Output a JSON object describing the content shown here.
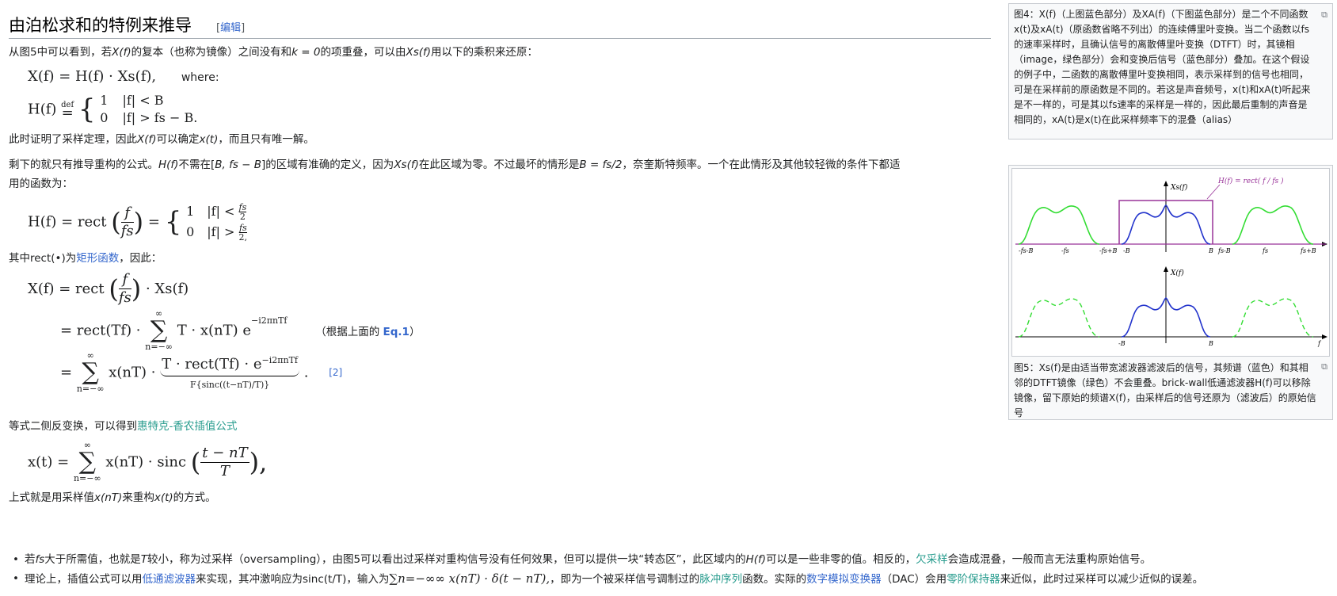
{
  "section": {
    "title": "由泊松求和的特例来推导",
    "edit_prefix": "[",
    "edit_label": "编辑",
    "edit_suffix": "]"
  },
  "para1": {
    "text_a": "从图5中可以看到，若",
    "xf": "X(f)",
    "text_b": "的复本（也称为镜像）之间没有和",
    "k0": "k = 0",
    "text_c": "的项重叠，可以由",
    "xsf": "Xs(f)",
    "text_d": "用以下的乘积来还原："
  },
  "eq1": {
    "lhs": "X(f) = H(f) · Xs(f),",
    "where": "where:"
  },
  "eq2": {
    "lhs": "H(f)",
    "def": "def",
    "eq": "=",
    "case1_val": "1",
    "case1_cond": "|f| < B",
    "case2_val": "0",
    "case2_cond": "|f| > fs − B."
  },
  "para2": {
    "text_a": "此时证明了采样定理，因此",
    "xf": "X(f)",
    "text_b": "可以确定",
    "xt": "x(t)",
    "text_c": "，而且只有唯一解。"
  },
  "para3": {
    "line1_a": "剩下的就只有推导重构的公式。",
    "hf": "H(f)",
    "line1_b": "不需在[",
    "range": "B, fs − B",
    "line1_c": "]的区域有准确的定义，因为",
    "xsf": "Xs(f)",
    "line1_d": "在此区域为零。不过最坏的情形是",
    "bfs": "B = fs/2",
    "line1_e": "，奈奎斯特频率。一个在此情形及其他较轻微的条件下都适",
    "line2": "用的函数为："
  },
  "eq3": {
    "lhs": "H(f) = rect",
    "num": "f",
    "den": "fs",
    "eq": "=",
    "c1v": "1",
    "c1c": "|f| <",
    "c1n": "fs",
    "c1d": "2",
    "c2v": "0",
    "c2c": "|f| >",
    "c2n": "fs",
    "c2d": "2,"
  },
  "para4": {
    "text_a": "其中rect(•)为",
    "link": "矩形函数",
    "text_b": "，因此："
  },
  "eq4": {
    "l1_lhs": "X(f) = rect",
    "l1_num": "f",
    "l1_den": "fs",
    "l1_rhs": "· Xs(f)",
    "l2_a": "= rect(Tf) ·",
    "sum_top": "∞",
    "sum_bot": "n=−∞",
    "l2_b": "T · x(nT) e",
    "l2_exp": "−i2πnTf",
    "l2_note_a": "（根据上面的 ",
    "l2_note_b": "Eq.1",
    "l2_note_c": "）",
    "l3_a": "=",
    "l3_b": "x(nT) ·",
    "l3_c": "T · rect(Tf) · e",
    "l3_exp": "−i2πnTf",
    "l3_d": ".",
    "ref": "[2]",
    "under": "F{sinc((t−nT)/T)}"
  },
  "para5": {
    "text_a": "等式二侧反变换，可以得到",
    "link": "惠特克-香农插值公式"
  },
  "eq5": {
    "lhs": "x(t) =",
    "sum_top": "∞",
    "sum_bot": "n=−∞",
    "body": "x(nT) · sinc",
    "num": "t − nT",
    "den": "T",
    "end": "),"
  },
  "para6": {
    "text_a": "上式就是用采样值",
    "xnt": "x(nT)",
    "text_b": "来重构",
    "xt": "x(t)",
    "text_c": "的方式。"
  },
  "bullets": [
    {
      "a": "若",
      "fs": "fs",
      "b": "大于所需值，也就是",
      "T": "T",
      "c": "较小，称为过采样（oversampling），由图5可以看出过采样对重构信号没有任何效果，但可以提供一块“转态区”，此区域内的",
      "hf": "H(f)",
      "d": "可以是一些非零的值。相反的，",
      "link": "欠采样",
      "e": "会造成混叠，一般而言无法重构原始信号。"
    },
    {
      "a": "理论上，插值公式可以用",
      "link1": "低通滤波器",
      "b": "来实现，其冲激响应为sinc(t/T)，输入为",
      "math": "∑n=−∞∞ x(nT) · δ(t − nT),",
      "c": "，即为一个被采样信号调制过的",
      "link2": "脉冲序列",
      "d": "函数。实际的",
      "link3": "数字模拟变换器",
      "e": "（DAC）会用",
      "link4": "零阶保持器",
      "f": "来近似，此时过采样可以减少近似的误差。"
    }
  ],
  "fig4": {
    "caption": "图4：X(f)（上图蓝色部分）及XA(f)（下图蓝色部分）是二个不同函数x(t)及xA(t)（原函数省略不列出）的连续傅里叶变换。当二个函数以fs的速率采样时，且确认信号的离散傅里叶变换（DTFT）时，其镜相（image，绿色部分）会和变换后信号（蓝色部分）叠加。在这个假设的例子中，二函数的离散傅里叶变换相同，表示采样到的信号也相同，可是在采样前的原函数是不同的。若这是声音频号，x(t)和xA(t)听起来是不一样的，可是其以fs速率的采样是一样的，因此最后重制的声音是相同的，xA(t)是x(t)在此采样频率下的混叠（alias）"
  },
  "fig5": {
    "label_top_y": "Xs(f)",
    "label_hf": "H(f) = rect( f / fs )",
    "label_bottom_y": "X(f)",
    "ticks_top": [
      "-fs-B",
      "-fs",
      "-fs+B",
      "-B",
      "B",
      "fs-B",
      "fs",
      "fs+B"
    ],
    "ticks_bottom": [
      "-B",
      "B"
    ],
    "f_label": "f",
    "caption": "图5：Xs(f)是由适当带宽滤波器滤波后的信号，其频谱（蓝色）和其相邻的DTFT镜像（绿色）不会重叠。brick-wall低通滤波器H(f)可以移除镜像，留下原始的频谱X(f)，由采样后的信号还原为（滤波后）的原始信号",
    "colors": {
      "blue": "#2233cc",
      "green": "#33dd33",
      "purple": "#993399"
    }
  }
}
